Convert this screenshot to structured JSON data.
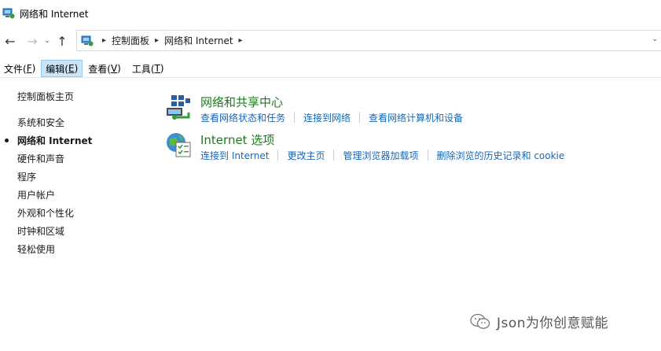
{
  "window": {
    "title": "网络和 Internet"
  },
  "addressbar": {
    "breadcrumbs": [
      "控制面板",
      "网络和 Internet"
    ]
  },
  "menubar": {
    "items": [
      {
        "label": "文件(F)",
        "text": "文件(",
        "key": "F",
        "tail": ")"
      },
      {
        "label": "编辑(E)",
        "text": "编辑(",
        "key": "E",
        "tail": ")",
        "active": true
      },
      {
        "label": "查看(V)",
        "text": "查看(",
        "key": "V",
        "tail": ")"
      },
      {
        "label": "工具(T)",
        "text": "工具(",
        "key": "T",
        "tail": ")"
      }
    ]
  },
  "sidebar": {
    "items": [
      {
        "label": "控制面板主页"
      },
      {
        "label": "系统和安全"
      },
      {
        "label": "网络和 Internet",
        "current": true
      },
      {
        "label": "硬件和声音"
      },
      {
        "label": "程序"
      },
      {
        "label": "用户帐户"
      },
      {
        "label": "外观和个性化"
      },
      {
        "label": "时钟和区域"
      },
      {
        "label": "轻松使用"
      }
    ]
  },
  "main": {
    "sections": [
      {
        "heading": "网络和共享中心",
        "icon": "network-sharing-center-icon",
        "links": [
          "查看网络状态和任务",
          "连接到网络",
          "查看网络计算机和设备"
        ]
      },
      {
        "heading": "Internet 选项",
        "icon": "internet-options-icon",
        "links": [
          "连接到 Internet",
          "更改主页",
          "管理浏览器加载项",
          "删除浏览的历史记录和 cookie"
        ]
      }
    ]
  },
  "watermark": {
    "text": "Json为你创意赋能"
  },
  "colors": {
    "heading_green": "#1e7a1e",
    "link_blue": "#1668b5",
    "menu_active_bg": "#cce4f7"
  }
}
